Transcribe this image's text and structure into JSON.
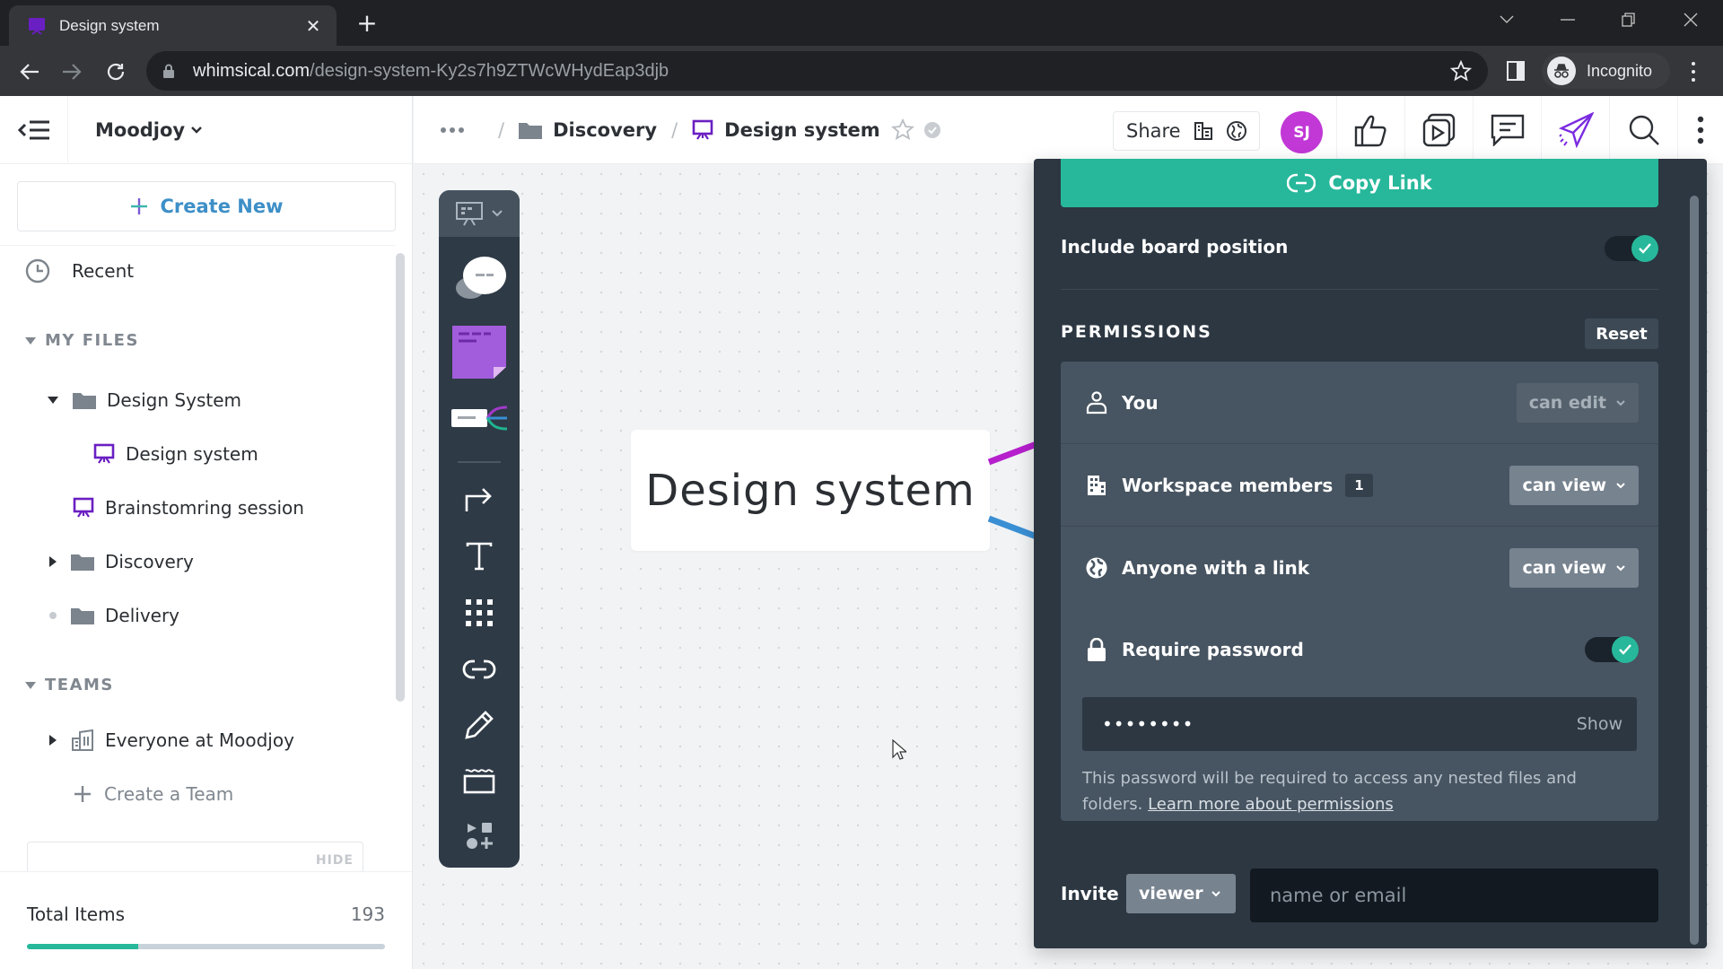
{
  "browser": {
    "tab_title": "Design system",
    "url_host": "whimsical.com",
    "url_path": "/design-system-Ky2s7h9ZTWcWHydEap3djb",
    "profile_label": "Incognito"
  },
  "sidebar": {
    "workspace": "Moodjoy",
    "create_new": "Create New",
    "recent": "Recent",
    "my_files_heading": "MY FILES",
    "files": [
      {
        "label": "Design System",
        "type": "folder",
        "expanded": true
      },
      {
        "label": "Design system",
        "type": "board"
      },
      {
        "label": "Brainstomring session",
        "type": "board"
      },
      {
        "label": "Discovery",
        "type": "folder",
        "expanded": false
      },
      {
        "label": "Delivery",
        "type": "folder",
        "empty": true
      }
    ],
    "teams_heading": "TEAMS",
    "teams": [
      {
        "label": "Everyone at Moodjoy"
      }
    ],
    "create_team": "Create a Team",
    "hide_label": "HIDE",
    "total_items_label": "Total Items",
    "total_items_value": "193",
    "total_items_progress_fraction": 0.31
  },
  "topbar": {
    "breadcrumbs": [
      {
        "label": "Discovery",
        "icon": "folder-icon"
      },
      {
        "label": "Design system",
        "icon": "board-icon"
      }
    ],
    "share_label": "Share",
    "avatar_initials": "SJ"
  },
  "canvas": {
    "card_text": "Design system",
    "connector_colors": [
      "#b51fcc",
      "#3a8fd4"
    ]
  },
  "share_panel": {
    "copy_link": "Copy Link",
    "include_board_position": "Include board position",
    "include_board_position_on": true,
    "permissions_heading": "PERMISSIONS",
    "reset": "Reset",
    "rows": [
      {
        "label": "You",
        "value": "can edit",
        "disabled": true
      },
      {
        "label": "Workspace members",
        "badge": "1",
        "value": "can view"
      },
      {
        "label": "Anyone with a link",
        "value": "can view"
      }
    ],
    "require_password": "Require password",
    "require_password_on": true,
    "password_masked": "••••••••",
    "show": "Show",
    "note_text": "This password will be required to access any nested files and folders.",
    "note_link": "Learn more about permissions",
    "invite_label": "Invite",
    "invite_role": "viewer",
    "invite_placeholder": "name or email"
  },
  "colors": {
    "accent_green": "#27b89b",
    "board_purple": "#6a1fc2",
    "avatar": "#c138d6",
    "link_blue": "#3d8fc7"
  }
}
